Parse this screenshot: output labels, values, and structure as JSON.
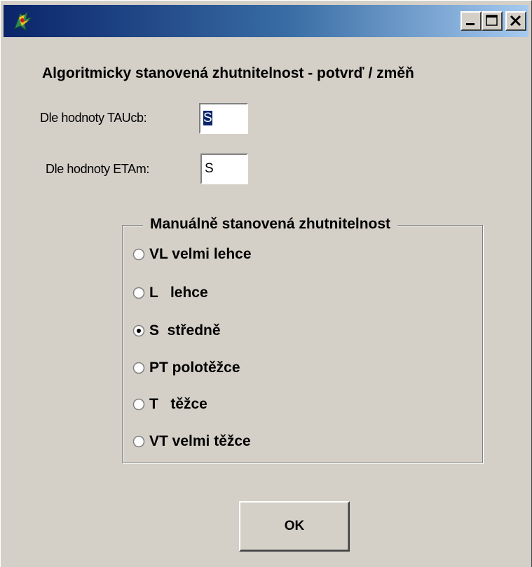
{
  "window": {
    "title": "",
    "icon": "app-logo-icon",
    "controls": {
      "minimize": "minimize-icon",
      "maximize": "maximize-icon",
      "close": "close-icon"
    }
  },
  "heading": "Algoritmicky stanovená zhutnitelnost - potvrď / změň",
  "fields": {
    "tau_label": "Dle hodnoty TAUcb:",
    "tau_value": "S",
    "eta_label": "Dle hodnoty ETAm:",
    "eta_value": "S"
  },
  "manual_group": {
    "title": "Manuálně stanovená zhutnitelnost",
    "selected": "S",
    "options": [
      {
        "code": "VL",
        "label": "VL velmi lehce"
      },
      {
        "code": "L",
        "label": "L   lehce"
      },
      {
        "code": "S",
        "label": "S  středně"
      },
      {
        "code": "PT",
        "label": "PT polotěžce"
      },
      {
        "code": "T",
        "label": "T   těžce"
      },
      {
        "code": "VT",
        "label": "VT velmi těžce"
      }
    ]
  },
  "buttons": {
    "ok": "OK"
  },
  "colors": {
    "face": "#d4d0c8",
    "title_start": "#0a246a",
    "title_end": "#a6caf0",
    "selection": "#0a246a"
  }
}
